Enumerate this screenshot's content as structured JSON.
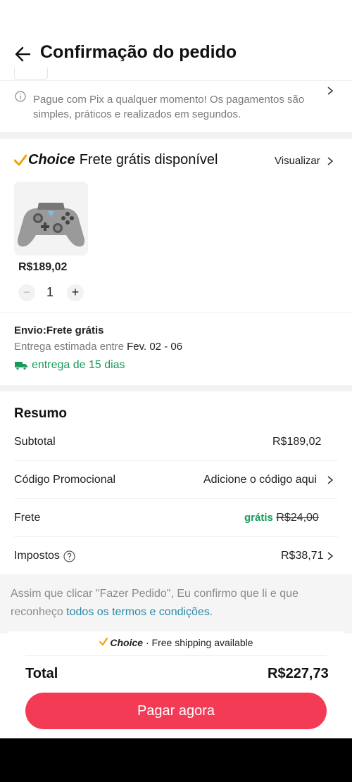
{
  "header": {
    "title": "Confirmação do pedido"
  },
  "pix": {
    "message": "Pague com Pix a qualquer momento! Os pagamentos são simples, práticos e realizados em segundos."
  },
  "shipping_header": {
    "choice": "Choice",
    "text": "Frete grátis disponível",
    "visualizar": "Visualizar"
  },
  "product": {
    "price": "R$189,02",
    "quantity": "1",
    "minus": "−",
    "plus": "+"
  },
  "delivery": {
    "envio": "Envio:Frete grátis",
    "estimate_prefix": "Entrega estimada entre",
    "estimate_dates": "Fev. 02 - 06",
    "days": "entrega de 15 dias"
  },
  "summary": {
    "title": "Resumo",
    "subtotal_label": "Subtotal",
    "subtotal_value": "R$189,02",
    "promo_label": "Código Promocional",
    "promo_value": "Adicione o código aqui",
    "frete_label": "Frete",
    "frete_gratis": "grátis",
    "frete_old": "R$24,00",
    "impostos_label": "Impostos",
    "impostos_value": "R$38,71"
  },
  "terms": {
    "text_before": "Assim que clicar \"Fazer Pedido\", Eu confirmo que li e que reconheço",
    "link": "todos os termos e condições",
    "text_after": "."
  },
  "footer": {
    "choice": "Choice",
    "banner": "· Free shipping available",
    "total_label": "Total",
    "total_value": "R$227,73",
    "pay_button": "Pagar agora"
  },
  "colors": {
    "accent": "#f43b56",
    "green": "#1a9a5a",
    "choice_check": "#f6a000",
    "link": "#2a8aa8"
  }
}
